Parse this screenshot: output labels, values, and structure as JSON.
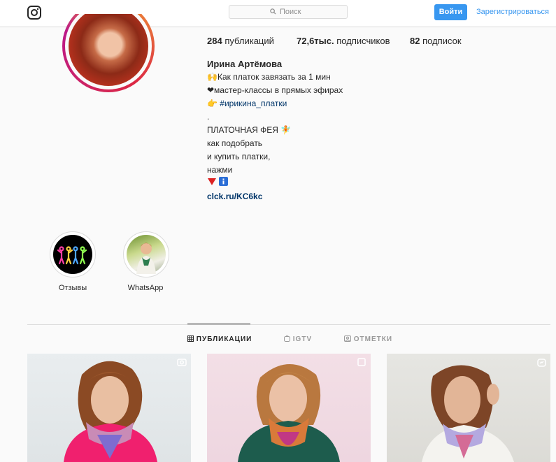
{
  "nav": {
    "search_placeholder": "Поиск",
    "login_label": "Войти",
    "register_label": "Зарегистрироваться"
  },
  "profile": {
    "stats": [
      {
        "count": "284",
        "label": "публикаций"
      },
      {
        "count": "72,6тыс.",
        "label": "подписчиков"
      },
      {
        "count": "82",
        "label": "подписок"
      }
    ],
    "full_name": "Ирина Артёмова",
    "bio_lines": [
      "Как платок завязать за 1 мин",
      "❤мастер-классы в прямых эфирах",
      "#ирикина_платки",
      ".",
      "ПЛАТОЧНАЯ ФЕЯ",
      "как подобрать",
      "и купить платки,",
      "нажми"
    ],
    "link": "clck.ru/KC6kc"
  },
  "highlights": [
    {
      "label": "Отзывы"
    },
    {
      "label": "WhatsApp"
    }
  ],
  "tabs": [
    {
      "label": "ПУБЛИКАЦИИ",
      "icon": "grid-icon",
      "active": true
    },
    {
      "label": "IGTV",
      "icon": "igtv-icon",
      "active": false
    },
    {
      "label": "ОТМЕТКИ",
      "icon": "tagged-icon",
      "active": false
    }
  ],
  "posts": [
    {
      "badge_icon": "video-icon"
    },
    {
      "badge_icon": "carousel-icon"
    },
    {
      "badge_icon": "igtv-icon"
    }
  ],
  "colors": {
    "accent": "#3897f0",
    "link": "#003569",
    "border": "#dbdbdb"
  }
}
